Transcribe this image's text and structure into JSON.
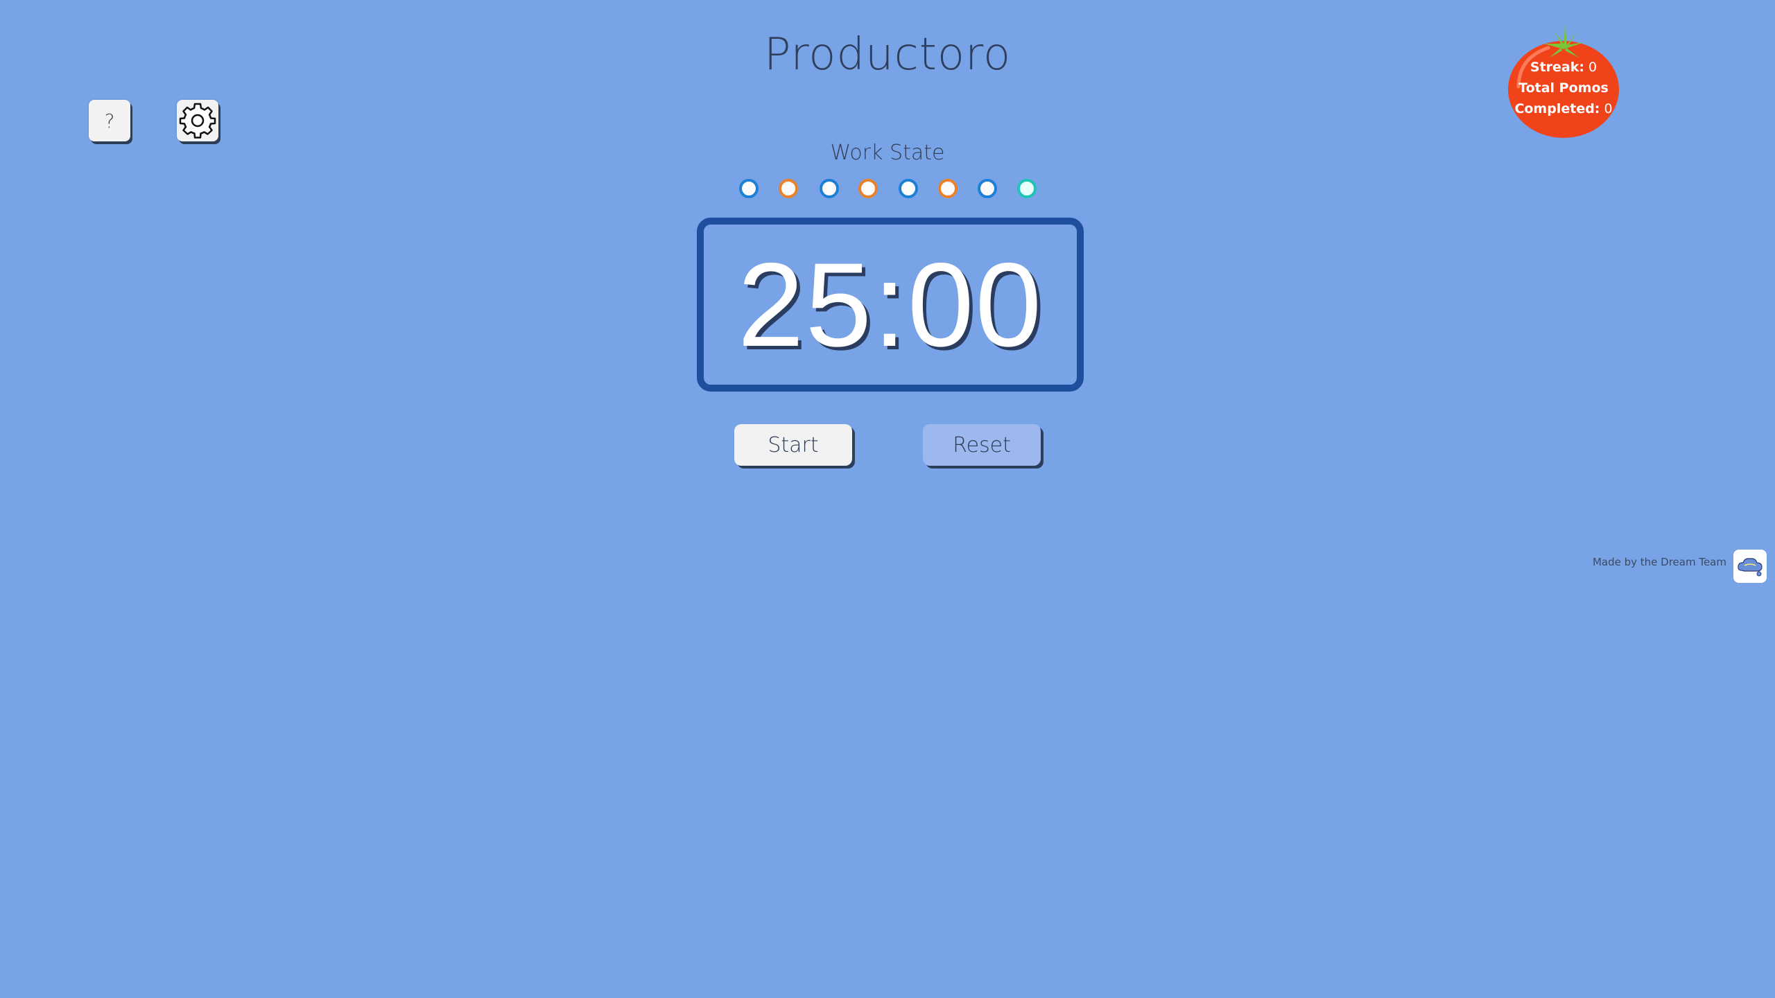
{
  "app": {
    "title": "Productoro"
  },
  "toolbar": {
    "help_label": "?",
    "settings_icon": "gear-icon"
  },
  "session": {
    "state_label": "Work State",
    "cycle_dots": [
      {
        "kind": "work",
        "color": "#1c7fd6"
      },
      {
        "kind": "short-break",
        "color": "#e8822a"
      },
      {
        "kind": "work",
        "color": "#1c7fd6"
      },
      {
        "kind": "short-break",
        "color": "#e8822a"
      },
      {
        "kind": "work",
        "color": "#1c7fd6"
      },
      {
        "kind": "short-break",
        "color": "#e8822a"
      },
      {
        "kind": "work",
        "color": "#1c7fd6"
      },
      {
        "kind": "long-break",
        "color": "#1fc4b8"
      }
    ]
  },
  "timer": {
    "display": "25:00"
  },
  "controls": {
    "start_label": "Start",
    "reset_label": "Reset"
  },
  "stats": {
    "streak_label": "Streak:",
    "streak_value": "0",
    "total_label_line1": "Total Pomos",
    "total_label_line2": "Completed:",
    "total_value": "0"
  },
  "footer": {
    "credit": "Made by the Dream Team",
    "logo_icon": "dream-team-logo"
  },
  "colors": {
    "background": "#78a3e6",
    "timer_border": "#1f4e9e",
    "tomato": "#f0431a",
    "stem": "#7bc43a"
  }
}
